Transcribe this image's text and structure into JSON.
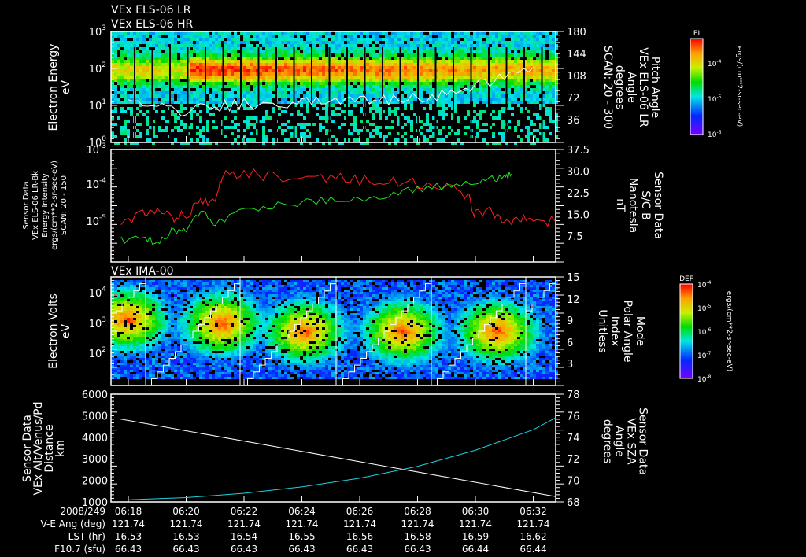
{
  "titles": [
    "VEx ELS-06 LR",
    "VEx ELS-06 HR"
  ],
  "panel3_title": "VEx IMA-00",
  "time_axis": {
    "date": "2008/249",
    "ticks": [
      "06:18",
      "06:20",
      "06:22",
      "06:24",
      "06:26",
      "06:28",
      "06:30",
      "06:32"
    ],
    "rows": [
      {
        "label": "V-E Ang (deg)",
        "values": [
          "121.74",
          "121.74",
          "121.74",
          "121.74",
          "121.74",
          "121.74",
          "121.74",
          "121.74"
        ]
      },
      {
        "label": "LST (hr)",
        "values": [
          "16.53",
          "16.53",
          "16.54",
          "16.55",
          "16.56",
          "16.58",
          "16.59",
          "16.62"
        ]
      },
      {
        "label": "F10.7 (sfu)",
        "values": [
          "66.43",
          "66.43",
          "66.43",
          "66.43",
          "66.43",
          "66.43",
          "66.44",
          "66.44"
        ]
      }
    ]
  },
  "chart_data": [
    {
      "type": "heatmap",
      "panel": "ELS energy spectrogram",
      "ylabel": [
        "Electron Energy",
        "eV"
      ],
      "yscale": "log",
      "ylim": [
        1,
        1000
      ],
      "yticks": [
        "10^0",
        "10^1",
        "10^2",
        "10^3"
      ],
      "right_ylabel": [
        "Pitch Angle",
        "VEx ELS-06 LR",
        "Angle",
        "degrees",
        "SCAN: 20 - 300"
      ],
      "right_ylim": [
        0,
        180
      ],
      "right_yticks": [
        "36",
        "72",
        "108",
        "144",
        "180"
      ],
      "colorbar": {
        "title": "EI",
        "ticks": [
          "10^-4",
          "10^-5",
          "10^-6"
        ],
        "label": "ergs/(cm**2-sr-sec-eV)",
        "scale": "log",
        "range": [
          1e-06,
          0.001
        ]
      },
      "overlay": {
        "name": "Pitch Angle",
        "color": "#ffffff",
        "x": [
          "06:18",
          "06:19",
          "06:20",
          "06:21",
          "06:22",
          "06:23",
          "06:24",
          "06:25",
          "06:26",
          "06:27",
          "06:28",
          "06:29",
          "06:30",
          "06:31",
          "06:32"
        ],
        "y": [
          68,
          55,
          50,
          58,
          62,
          60,
          66,
          70,
          72,
          70,
          74,
          76,
          90,
          110,
          122
        ]
      }
    },
    {
      "type": "line",
      "panel": "ELS energy intensity and magnetic field",
      "ylabel": [
        "Sensor Data",
        "VEx ELS-06 LR-Bk",
        "Energy Intensity",
        "ergs/(cm**2-sr-sec-eV)",
        "SCAN: 20 - 150"
      ],
      "yscale": "log",
      "ylim": [
        7e-07,
        0.001
      ],
      "yticks": [
        "10^-3",
        "10^-4",
        "10^-5"
      ],
      "right_ylabel": [
        "Sensor Data",
        "S/C B",
        "Nanotesla",
        "nT"
      ],
      "right_ylim": [
        -1.5,
        37.5
      ],
      "right_yticks": [
        "7.5",
        "15.0",
        "22.5",
        "30.0",
        "37.5"
      ],
      "series": [
        {
          "axis": "left",
          "color": "#ff2020",
          "x": [
            "06:17:45",
            "06:18:30",
            "06:19",
            "06:19:30",
            "06:20",
            "06:20:30",
            "06:21",
            "06:21:15",
            "06:22",
            "06:23",
            "06:24",
            "06:25",
            "06:26",
            "06:27",
            "06:28",
            "06:29",
            "06:29:45",
            "06:30",
            "06:30:30",
            "06:31",
            "06:31:30",
            "06:32",
            "06:32:45"
          ],
          "y": [
            8e-06,
            1.5e-05,
            2e-05,
            1.2e-05,
            1.5e-05,
            3e-05,
            4e-05,
            0.0002,
            0.00021,
            0.00018,
            0.00016,
            0.00017,
            0.00014,
            0.00013,
            0.00011,
            9e-05,
            5e-05,
            1.5e-05,
            2e-05,
            1e-05,
            1.1e-05,
            1e-05,
            1e-05
          ]
        },
        {
          "axis": "right",
          "color": "#20e020",
          "x": [
            "06:17:45",
            "06:18:30",
            "06:19",
            "06:19:30",
            "06:20",
            "06:20:30",
            "06:21",
            "06:22",
            "06:23",
            "06:24",
            "06:25",
            "06:26",
            "06:27",
            "06:28",
            "06:29",
            "06:30",
            "06:30:30",
            "06:31",
            "06:31:15"
          ],
          "y": [
            6,
            7,
            5,
            9,
            10,
            16,
            12,
            17,
            18,
            19,
            20,
            20,
            22,
            24,
            25,
            26,
            27,
            28,
            29
          ]
        }
      ]
    },
    {
      "type": "heatmap",
      "panel": "IMA spectrogram",
      "ylabel": [
        "Electron Volts",
        "eV"
      ],
      "yscale": "log",
      "ylim": [
        8,
        30000
      ],
      "yticks": [
        "10^2",
        "10^3",
        "10^4"
      ],
      "right_ylabel": [
        "Mode",
        "Polar Angle",
        "Index",
        "Unitless"
      ],
      "right_ylim": [
        0,
        15
      ],
      "right_yticks": [
        "3",
        "6",
        "9",
        "12",
        "15"
      ],
      "colorbar": {
        "title": "DEF",
        "ticks": [
          "10^-4",
          "10^-5",
          "10^-6",
          "10^-7",
          "10^-8"
        ],
        "label": "ergs/(cm**2-sr-sec-eV)",
        "scale": "log",
        "range": [
          1e-08,
          0.0001
        ]
      }
    },
    {
      "type": "line",
      "panel": "Orbit",
      "ylabel": [
        "Sensor Data",
        "VEx Alt/Venus/Pd",
        "Distance",
        "km"
      ],
      "ylim": [
        1000,
        6000
      ],
      "yticks": [
        "1000",
        "2000",
        "3000",
        "4000",
        "5000",
        "6000"
      ],
      "right_ylabel": [
        "Sensor Data",
        "VEx SZA",
        "Angle",
        "degrees"
      ],
      "right_ylim": [
        68,
        78
      ],
      "right_yticks": [
        "68",
        "70",
        "72",
        "74",
        "76",
        "78"
      ],
      "series": [
        {
          "axis": "left",
          "color": "#ffffff",
          "x": [
            "06:17:42",
            "06:32:46"
          ],
          "y": [
            4850,
            1250
          ]
        },
        {
          "axis": "right",
          "color": "#20d0e0",
          "x": [
            "06:18",
            "06:20",
            "06:22",
            "06:24",
            "06:26",
            "06:28",
            "06:30",
            "06:32",
            "06:32:46"
          ],
          "y": [
            68.2,
            68.4,
            68.8,
            69.4,
            70.2,
            71.3,
            72.8,
            74.7,
            75.8
          ]
        }
      ]
    }
  ]
}
